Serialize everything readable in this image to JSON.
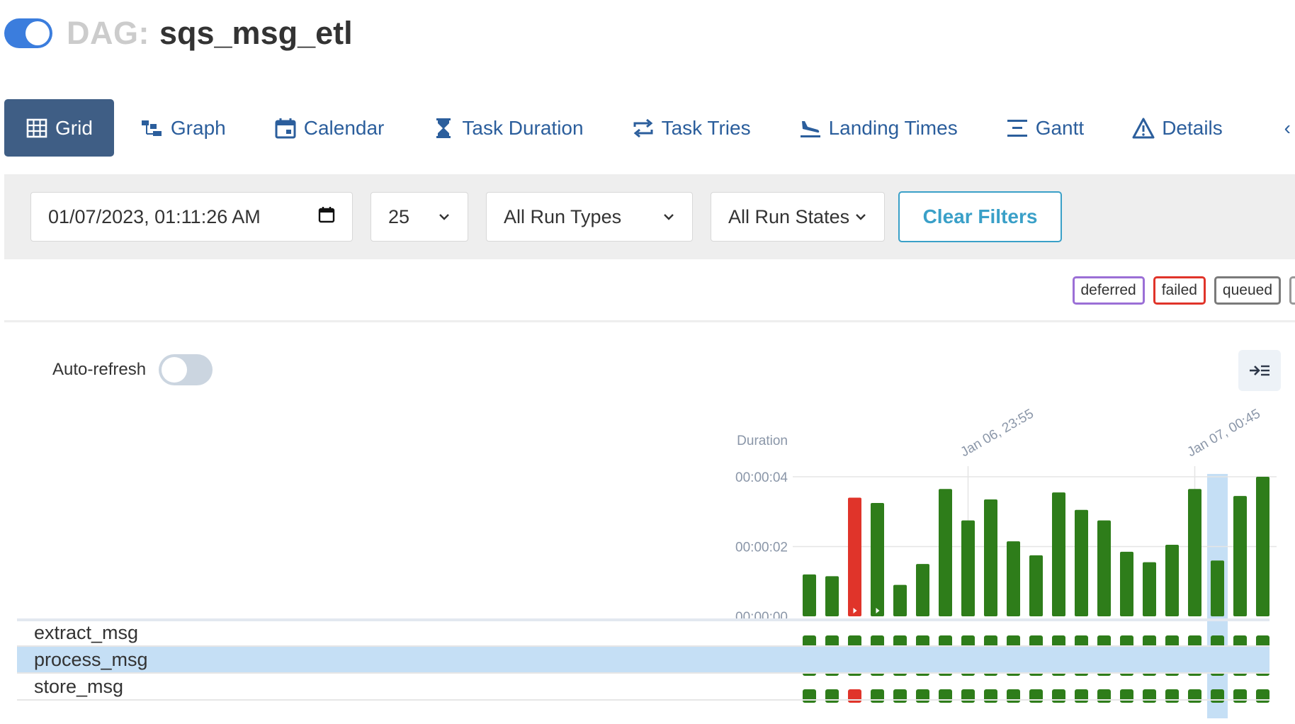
{
  "header": {
    "prefix": "DAG:",
    "dag_id": "sqs_msg_etl"
  },
  "tabs": [
    {
      "label": "Grid",
      "icon": "grid-icon",
      "active": true
    },
    {
      "label": "Graph",
      "icon": "graph-icon"
    },
    {
      "label": "Calendar",
      "icon": "calendar-icon"
    },
    {
      "label": "Task Duration",
      "icon": "hourglass-icon"
    },
    {
      "label": "Task Tries",
      "icon": "repeat-icon"
    },
    {
      "label": "Landing Times",
      "icon": "plane-landing-icon"
    },
    {
      "label": "Gantt",
      "icon": "gantt-icon"
    },
    {
      "label": "Details",
      "icon": "warning-triangle-icon"
    }
  ],
  "filters": {
    "base_date": "01/07/2023, 01:11:26 AM",
    "num_runs": "25",
    "run_type": "All Run Types",
    "run_state": "All Run States",
    "clear_label": "Clear Filters"
  },
  "legend": [
    "deferred",
    "failed",
    "queued"
  ],
  "autorefresh_label": "Auto-refresh",
  "chart_data": {
    "type": "bar",
    "ylabel": "Duration",
    "yticks": [
      "00:00:00",
      "00:00:02",
      "00:00:04"
    ],
    "ylim": [
      0,
      4
    ],
    "date_labels": [
      {
        "index": 7,
        "label": "Jan 06, 23:55"
      },
      {
        "index": 17,
        "label": "Jan 07, 00:45"
      }
    ],
    "values": [
      1.2,
      1.15,
      3.4,
      3.25,
      0.9,
      1.5,
      3.65,
      2.75,
      3.35,
      2.15,
      1.75,
      3.55,
      3.05,
      2.75,
      1.85,
      1.55,
      2.05,
      3.65,
      1.6,
      3.45,
      4.0
    ],
    "states": [
      "success",
      "success",
      "failed",
      "success",
      "success",
      "success",
      "success",
      "success",
      "success",
      "success",
      "success",
      "success",
      "success",
      "success",
      "success",
      "success",
      "success",
      "success",
      "success",
      "success",
      "success"
    ],
    "markers": [
      2,
      3
    ],
    "selected_run": 18
  },
  "tasks": [
    {
      "task_id": "extract_msg",
      "states": [
        "success",
        "success",
        "success",
        "success",
        "success",
        "success",
        "success",
        "success",
        "success",
        "success",
        "success",
        "success",
        "success",
        "success",
        "success",
        "success",
        "success",
        "success",
        "success",
        "success",
        "success"
      ]
    },
    {
      "task_id": "process_msg",
      "states": [
        "success",
        "success",
        "success",
        "success",
        "success",
        "success",
        "success",
        "success",
        "success",
        "success",
        "success",
        "success",
        "success",
        "success",
        "success",
        "success",
        "success",
        "success",
        "success",
        "success",
        "success"
      ]
    },
    {
      "task_id": "store_msg",
      "states": [
        "success",
        "success",
        "failed",
        "success",
        "success",
        "success",
        "success",
        "success",
        "success",
        "success",
        "success",
        "success",
        "success",
        "success",
        "success",
        "success",
        "success",
        "success",
        "success",
        "success",
        "success"
      ]
    }
  ],
  "colors": {
    "success": "#2e7d1a",
    "failed": "#e0342a",
    "selected": "#c5dff5",
    "accent": "#3f5e85"
  }
}
